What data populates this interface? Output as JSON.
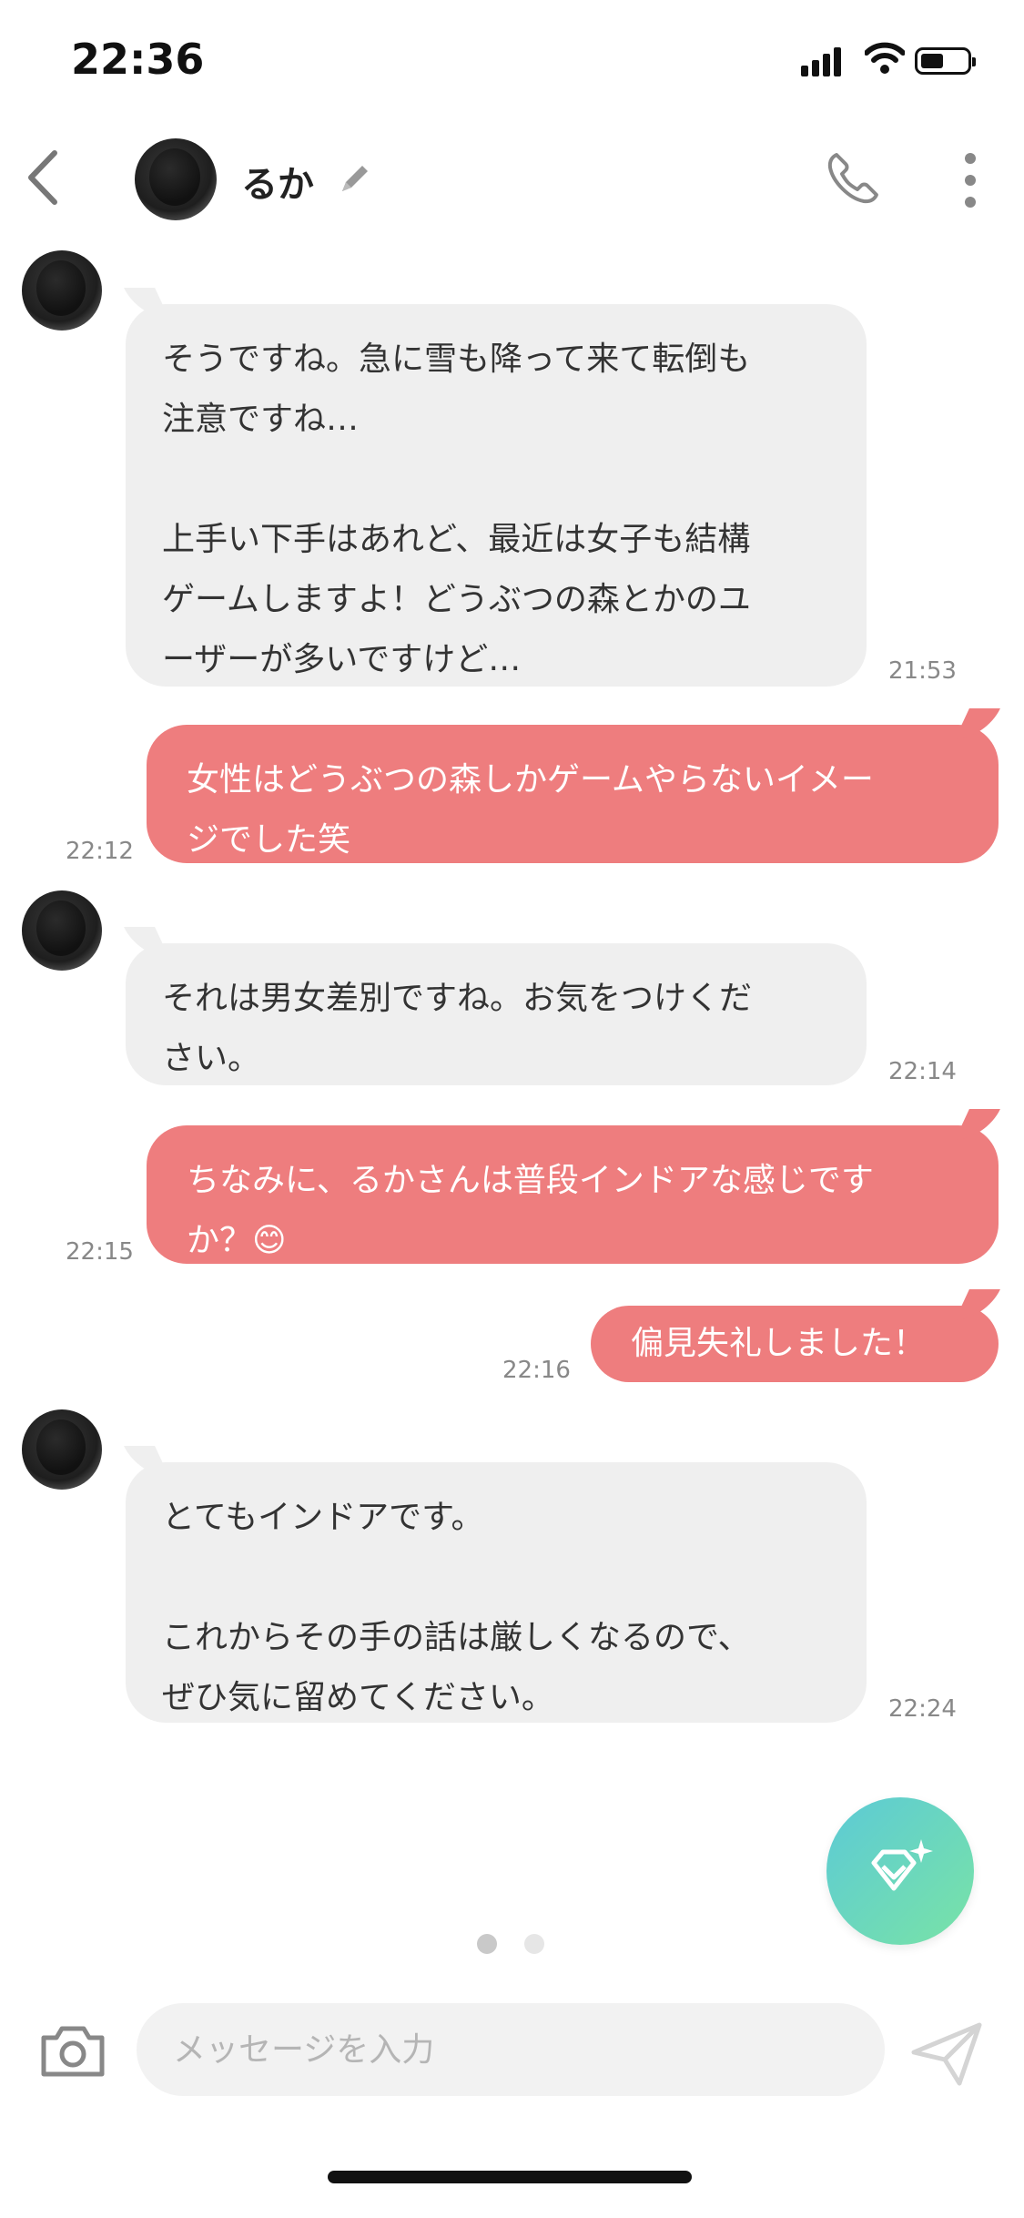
{
  "status_bar": {
    "time": "22:36"
  },
  "header": {
    "contact_name": "るか"
  },
  "messages": [
    {
      "direction": "in",
      "text": "そうですね。急に雪も降って来て転倒も\n注意ですね…\n\n上手い下手はあれど、最近は女子も結構\nゲームしますよ！どうぶつの森とかのユ\nーザーが多いですけど…",
      "time": "21:53"
    },
    {
      "direction": "out",
      "text": "女性はどうぶつの森しかゲームやらないイメー\nジでした笑",
      "time": "22:12"
    },
    {
      "direction": "in",
      "text": "それは男女差別ですね。お気をつけくだ\nさい。",
      "time": "22:14"
    },
    {
      "direction": "out",
      "text": "ちなみに、るかさんは普段インドアな感じです\nか？😊",
      "time": "22:15"
    },
    {
      "direction": "out",
      "text": "偏見失礼しました！",
      "time": "22:16"
    },
    {
      "direction": "in",
      "text": "とてもインドアです。\n\nこれからその手の話は厳しくなるので、\nぜひ気に留めてください。",
      "time": "22:24"
    }
  ],
  "pager": {
    "active_index": 0,
    "count": 2
  },
  "input": {
    "placeholder": "メッセージを入力",
    "value": ""
  },
  "colors": {
    "outgoing_bubble": "#ee7d7e",
    "incoming_bubble": "#efefef",
    "fab_gradient_start": "#5ccad6",
    "fab_gradient_end": "#79e3a6"
  }
}
